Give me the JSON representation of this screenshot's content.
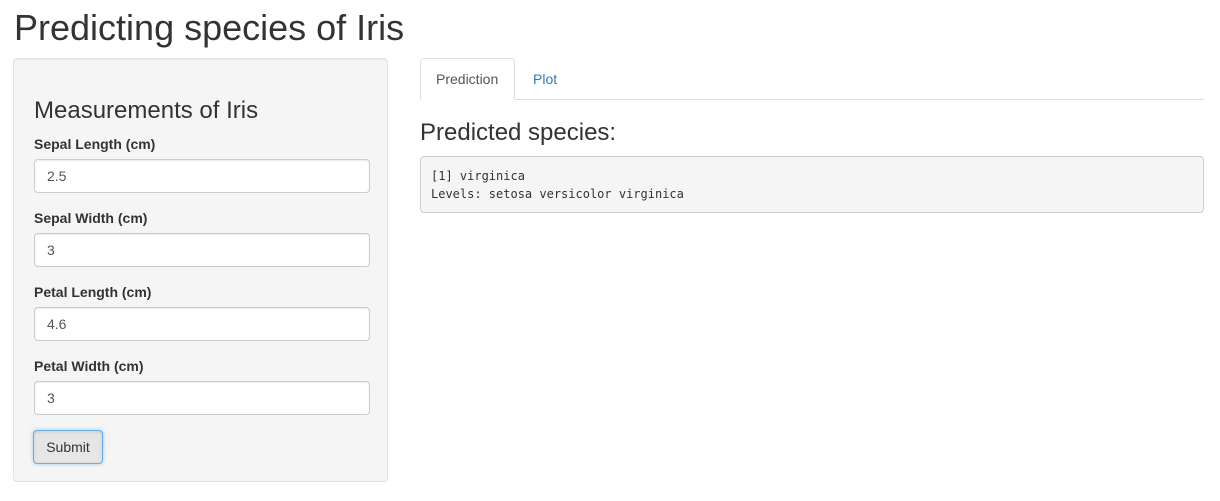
{
  "page": {
    "title": "Predicting species of Iris"
  },
  "sidebar": {
    "heading": "Measurements of Iris",
    "fields": [
      {
        "label": "Sepal Length (cm)",
        "value": "2.5"
      },
      {
        "label": "Sepal Width (cm)",
        "value": "3"
      },
      {
        "label": "Petal Length (cm)",
        "value": "4.6"
      },
      {
        "label": "Petal Width (cm)",
        "value": "3"
      }
    ],
    "submit_label": "Submit"
  },
  "tabs": [
    {
      "label": "Prediction",
      "active": true
    },
    {
      "label": "Plot",
      "active": false
    }
  ],
  "output": {
    "heading": "Predicted species:",
    "lines": [
      "[1] virginica",
      "Levels: setosa versicolor virginica"
    ]
  },
  "colors": {
    "link": "#337ab7",
    "well_background": "#f5f5f5",
    "focus_border": "#66afe9"
  }
}
